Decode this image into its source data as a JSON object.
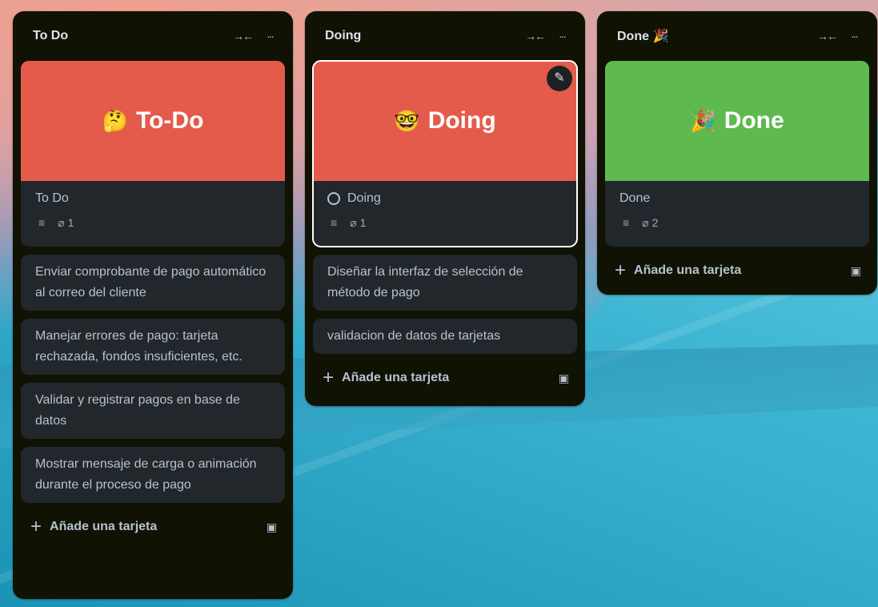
{
  "lists": [
    {
      "title": "To Do",
      "cover": {
        "emoji": "🤔",
        "text": "To-Do",
        "color": "#e55b4b"
      },
      "cover_card": {
        "title": "To Do",
        "attachments": "1"
      },
      "cards": [
        "Enviar comprobante de pago automático al correo del cliente",
        "Manejar errores de pago: tarjeta rechazada, fondos insuficientes, etc.",
        "Validar y registrar pagos en base de datos",
        "Mostrar mensaje de carga o animación durante el proceso de pago"
      ],
      "add_label": "Añade una tarjeta"
    },
    {
      "title": "Doing",
      "cover": {
        "emoji": "🤓",
        "text": "Doing",
        "color": "#e55b4b"
      },
      "cover_card": {
        "title": "Doing",
        "attachments": "1"
      },
      "cards": [
        "Diseñar la interfaz de selección de método de pago",
        "validacion de datos de tarjetas"
      ],
      "add_label": "Añade una tarjeta"
    },
    {
      "title": "Done 🎉",
      "cover": {
        "emoji": "🎉",
        "text": "Done",
        "color": "#5eba4f"
      },
      "cover_card": {
        "title": "Done",
        "attachments": "2"
      },
      "cards": [],
      "add_label": "Añade una tarjeta"
    }
  ],
  "icons": {
    "collapse": "collapse-icon",
    "more": "more-icon",
    "description": "description-icon",
    "attachment": "attachment-icon",
    "plus": "plus-icon",
    "template": "template-icon",
    "edit": "edit-icon"
  }
}
